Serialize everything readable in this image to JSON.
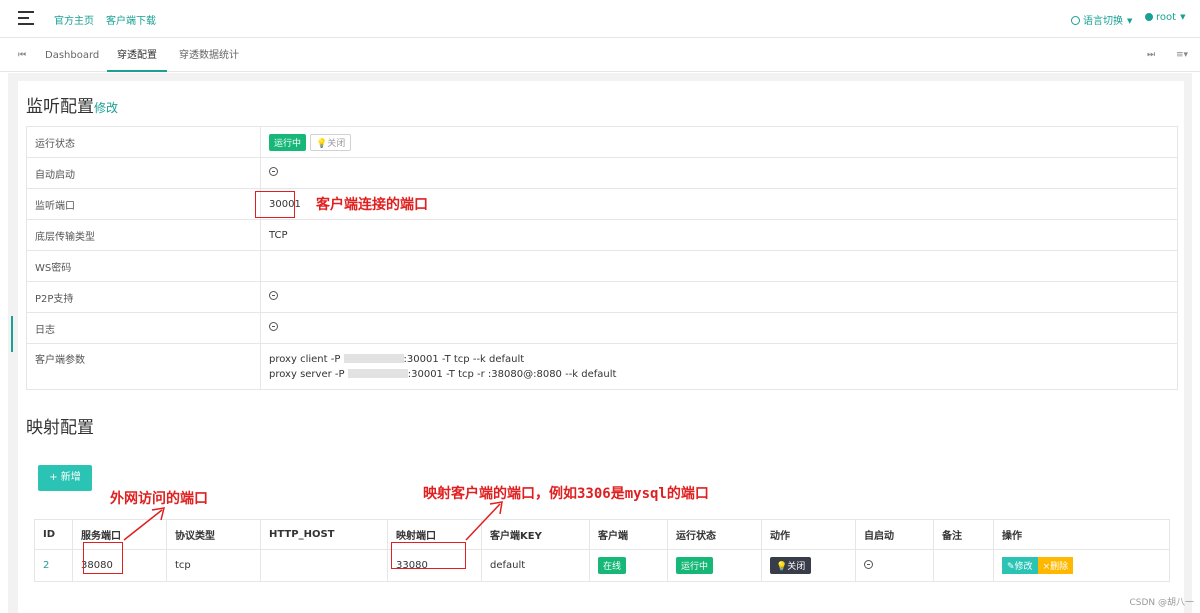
{
  "topbar": {
    "menu_icon": "hamburger-icon",
    "links": [
      "官方主页",
      "客户端下载"
    ],
    "language_label": "语言切换",
    "user_label": "root"
  },
  "tabs": {
    "items": [
      "Dashboard",
      "穿透配置",
      "穿透数据统计"
    ],
    "active": "穿透配置"
  },
  "listen": {
    "title": "监听配置",
    "edit_label": "修改",
    "rows": {
      "status_label": "运行状态",
      "status_running": "运行中",
      "status_close": "关闭",
      "autostart_label": "自动启动",
      "port_label": "监听端口",
      "port_value": "30001",
      "transport_label": "底层传输类型",
      "transport_value": "TCP",
      "ws_label": "WS密码",
      "p2p_label": "P2P支持",
      "log_label": "日志",
      "params_label": "客户端参数",
      "client_cmd_a": "proxy client -P",
      "client_cmd_b": ":30001 -T tcp --k default",
      "server_cmd_a": "proxy server -P",
      "server_cmd_b": ":30001 -T tcp -r :38080@:8080 --k default"
    }
  },
  "mapping": {
    "title": "映射配置",
    "add_label": "+ 新增",
    "headers": [
      "ID",
      "服务端口",
      "协议类型",
      "HTTP_HOST",
      "映射端口",
      "客户端KEY",
      "客户端",
      "运行状态",
      "动作",
      "自启动",
      "备注",
      "操作"
    ],
    "row": {
      "id": "2",
      "service_port": "38080",
      "protocol": "tcp",
      "http_host": "",
      "map_port": "33080",
      "client_key": "default",
      "client_status": "在线",
      "run_status": "运行中",
      "action": "关闭",
      "remark": "",
      "edit": "修改",
      "delete": "删除"
    }
  },
  "annotations": {
    "listen_port_note": "客户端连接的端口",
    "service_port_note": "外网访问的端口",
    "map_port_note": "映射客户端的端口，例如3306是mysql的端口"
  },
  "watermark": "CSDN @胡八一",
  "colors": {
    "accent": "#1aa094",
    "green": "#16b777",
    "annotation_red": "#e02020",
    "orange": "#ffb800"
  }
}
